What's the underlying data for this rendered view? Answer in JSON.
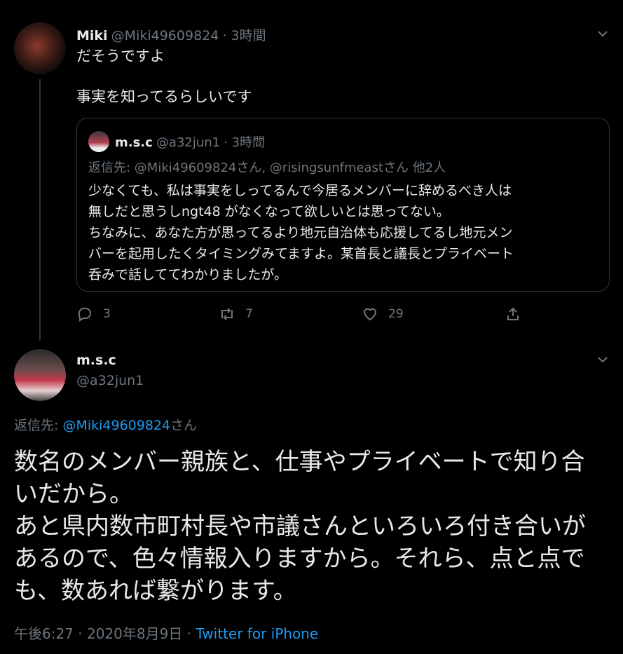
{
  "tweet1": {
    "name": "Miki",
    "handle": "@Miki49609824",
    "time": "· 3時間",
    "line1": "だそうですよ",
    "line2": "事実を知ってるらしいです",
    "quote": {
      "name": "m.s.c",
      "handle": "@a32jun1",
      "time": "· 3時間",
      "reply_to": "返信先: @Miki49609824さん, @risingsunfmeastさん 他2人",
      "lines": [
        "少なくても、私は事実をしってるんで今居るメンバーに辞めるべき人は",
        "無しだと思うしngt48 がなくなって欲しいとは思ってない。",
        "ちなみに、あなた方が思ってるより地元自治体も応援してるし地元メン",
        "バーを起用したくタイミングみてますよ。某首長と議長とプライベート",
        "呑みで話しててわかりましたが。"
      ]
    },
    "actions": {
      "replies": "3",
      "retweets": "7",
      "likes": "29"
    }
  },
  "tweet2": {
    "name": "m.s.c",
    "handle": "@a32jun1",
    "reply_prefix": "返信先: ",
    "reply_handle": "@Miki49609824",
    "reply_suffix": "さん",
    "lines": [
      "数名のメンバー親族と、仕事やプライベートで知り合",
      "いだから。",
      "あと県内数市町村長や市議さんといろいろ付き合いが",
      "あるので、色々情報入りますから。それら、点と点で",
      "も、数あれば繋がります。"
    ],
    "timestamp": "午後6:27 · 2020年8月9日 · ",
    "source": "Twitter for iPhone"
  },
  "icons": {
    "more": "chevron-down-icon",
    "reply": "reply-icon",
    "retweet": "retweet-icon",
    "like": "heart-icon",
    "share": "share-icon"
  }
}
